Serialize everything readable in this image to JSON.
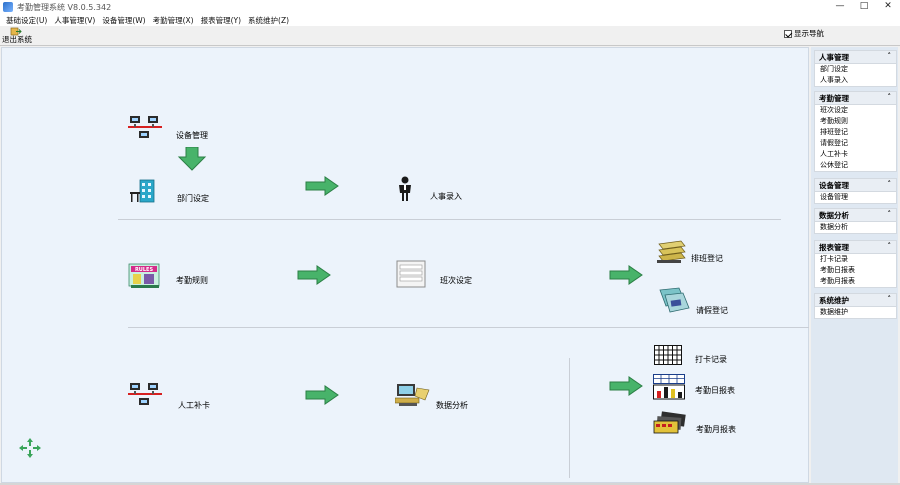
{
  "window": {
    "title": "考勤管理系统 V8.0.5.342",
    "controls": [
      "—",
      "□",
      "✕"
    ]
  },
  "menu": [
    "基础设定(U)",
    "人事管理(V)",
    "设备管理(W)",
    "考勤管理(X)",
    "报表管理(Y)",
    "系统维护(Z)"
  ],
  "toolbar": {
    "exit_label": "退出系统",
    "nav_toggle_label": "显示导航"
  },
  "flow": {
    "device_mgmt": "设备管理",
    "dept_setup": "部门设定",
    "personnel_entry": "人事录入",
    "attendance_rules": "考勤规则",
    "shift_setup": "班次设定",
    "shift_register": "排班登记",
    "leave_register": "请假登记",
    "manual_punch": "人工补卡",
    "data_analysis": "数据分析",
    "punch_records": "打卡记录",
    "daily_report": "考勤日报表",
    "monthly_report": "考勤月报表"
  },
  "nav": {
    "personnel": {
      "title": "人事管理",
      "items": [
        "部门设定",
        "人事录入"
      ]
    },
    "attendance": {
      "title": "考勤管理",
      "items": [
        "班次设定",
        "考勤规则",
        "排班登记",
        "请假登记",
        "人工补卡",
        "公休登记"
      ]
    },
    "device": {
      "title": "设备管理",
      "items": [
        "设备管理"
      ]
    },
    "analysis": {
      "title": "数据分析",
      "items": [
        "数据分析"
      ]
    },
    "reports": {
      "title": "报表管理",
      "items": [
        "打卡记录",
        "考勤日报表",
        "考勤月报表"
      ]
    },
    "system": {
      "title": "系统维护",
      "items": [
        "数据维护"
      ]
    }
  },
  "colors": {
    "accent_green": "#3aa45a",
    "canvas_bg": "#ecf3fb",
    "nav_bg": "#dfe8f2"
  }
}
